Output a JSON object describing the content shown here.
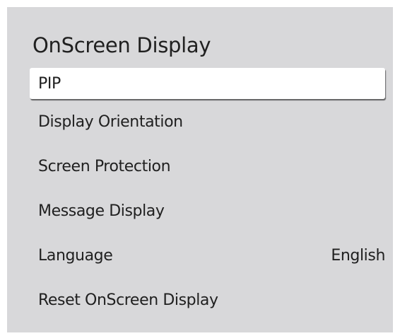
{
  "menu": {
    "title": "OnScreen Display",
    "items": [
      {
        "label": "PIP",
        "value": ""
      },
      {
        "label": "Display Orientation",
        "value": ""
      },
      {
        "label": "Screen Protection",
        "value": ""
      },
      {
        "label": "Message Display",
        "value": ""
      },
      {
        "label": "Language",
        "value": "English"
      },
      {
        "label": "Reset OnScreen Display",
        "value": ""
      }
    ],
    "selected_index": 0
  }
}
